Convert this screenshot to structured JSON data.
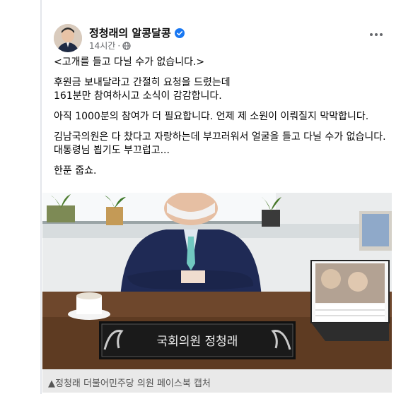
{
  "post": {
    "author": "정청래의 알콩달콩",
    "time": "14시간",
    "paragraphs": [
      "<고개를 들고 다닐 수가 없습니다.>",
      "후원금 보내달라고 간절히 요청을 드렸는데\n161분만 참여하시고 소식이 감감합니다.",
      "아직 1000분의 참여가 더 필요합니다. 언제 제 소원이 이뤄질지 막막합니다.",
      "김남국의원은 다 찼다고 자랑하는데 부끄러워서 얼굴을 들고 다닐 수가 없습니다. 대통령님 뵙기도 부끄럽고...",
      "한푼 줍쇼."
    ],
    "photo": {
      "nameplate": "국회의원 정청래"
    },
    "caption": "▲정청래 더불어민주당 의원 페이스북 캡처"
  },
  "icons": {
    "verified": "verified-badge-icon",
    "privacy": "globe-icon",
    "more": "more-options-icon"
  },
  "colors": {
    "verified": "#1877f2",
    "meta": "#65676b"
  }
}
